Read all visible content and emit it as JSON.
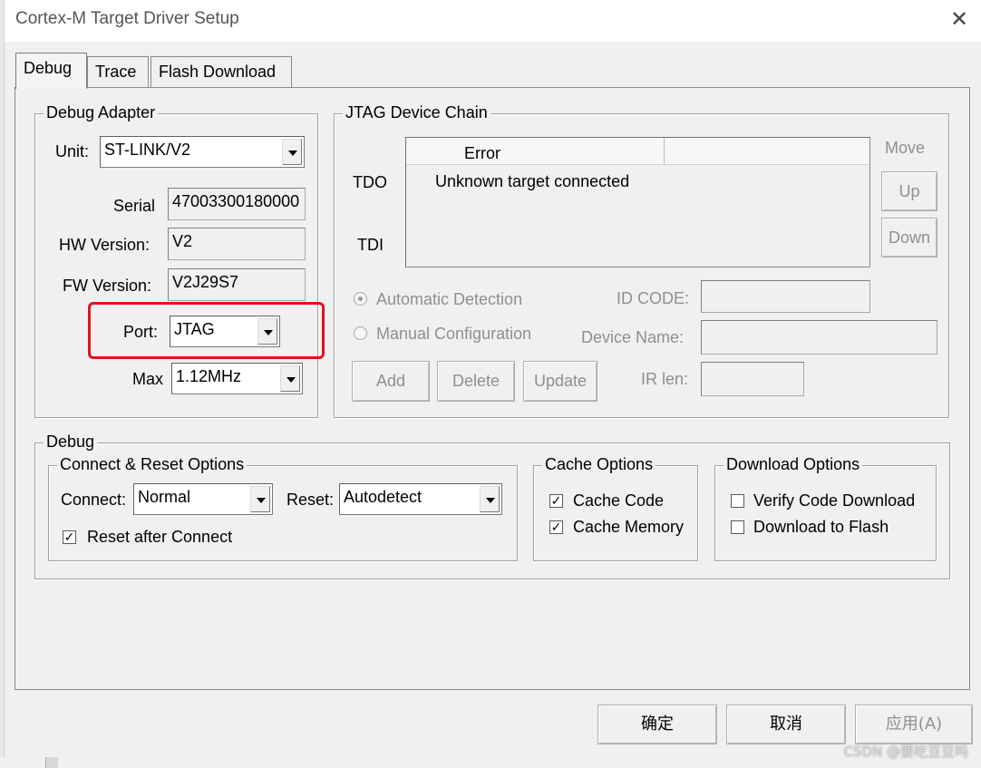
{
  "window": {
    "title": "Cortex-M Target Driver Setup"
  },
  "tabs": [
    "Debug",
    "Trace",
    "Flash Download"
  ],
  "debug_adapter": {
    "legend": "Debug Adapter",
    "unit_label": "Unit:",
    "unit_value": "ST-LINK/V2",
    "serial_label": "Serial",
    "serial_value": "47003300180000",
    "hw_label": "HW Version:",
    "hw_value": "V2",
    "fw_label": "FW Version:",
    "fw_value": "V2J29S7",
    "port_label": "Port:",
    "port_value": "JTAG",
    "max_label": "Max",
    "max_value": "1.12MHz",
    "highlight_color": "#e0131b"
  },
  "jtag_chain": {
    "legend": "JTAG Device Chain",
    "tdo_label": "TDO",
    "tdi_label": "TDI",
    "column_header": "Error",
    "rows": [
      "Unknown target connected"
    ],
    "move_label": "Move",
    "up_button": "Up",
    "down_button": "Down",
    "auto_detection": "Automatic Detection",
    "manual_config": "Manual Configuration",
    "id_code_label": "ID CODE:",
    "device_name_label": "Device Name:",
    "ir_len_label": "IR len:",
    "add_button": "Add",
    "delete_button": "Delete",
    "update_button": "Update"
  },
  "debug": {
    "legend": "Debug",
    "connect_reset": {
      "legend": "Connect & Reset Options",
      "connect_label": "Connect:",
      "connect_value": "Normal",
      "reset_label": "Reset:",
      "reset_value": "Autodetect",
      "reset_after_connect": "Reset after Connect",
      "reset_after_connect_checked": true
    },
    "cache_options": {
      "legend": "Cache Options",
      "cache_code": "Cache Code",
      "cache_code_checked": true,
      "cache_memory": "Cache Memory",
      "cache_memory_checked": true
    },
    "download_options": {
      "legend": "Download Options",
      "verify_code": "Verify Code Download",
      "verify_code_checked": false,
      "download_flash": "Download to Flash",
      "download_flash_checked": false
    }
  },
  "footer": {
    "ok_button": "确定",
    "cancel_button": "取消",
    "apply_button": "应用(A)"
  },
  "watermark": "CSDN @要吃豆豆吗"
}
